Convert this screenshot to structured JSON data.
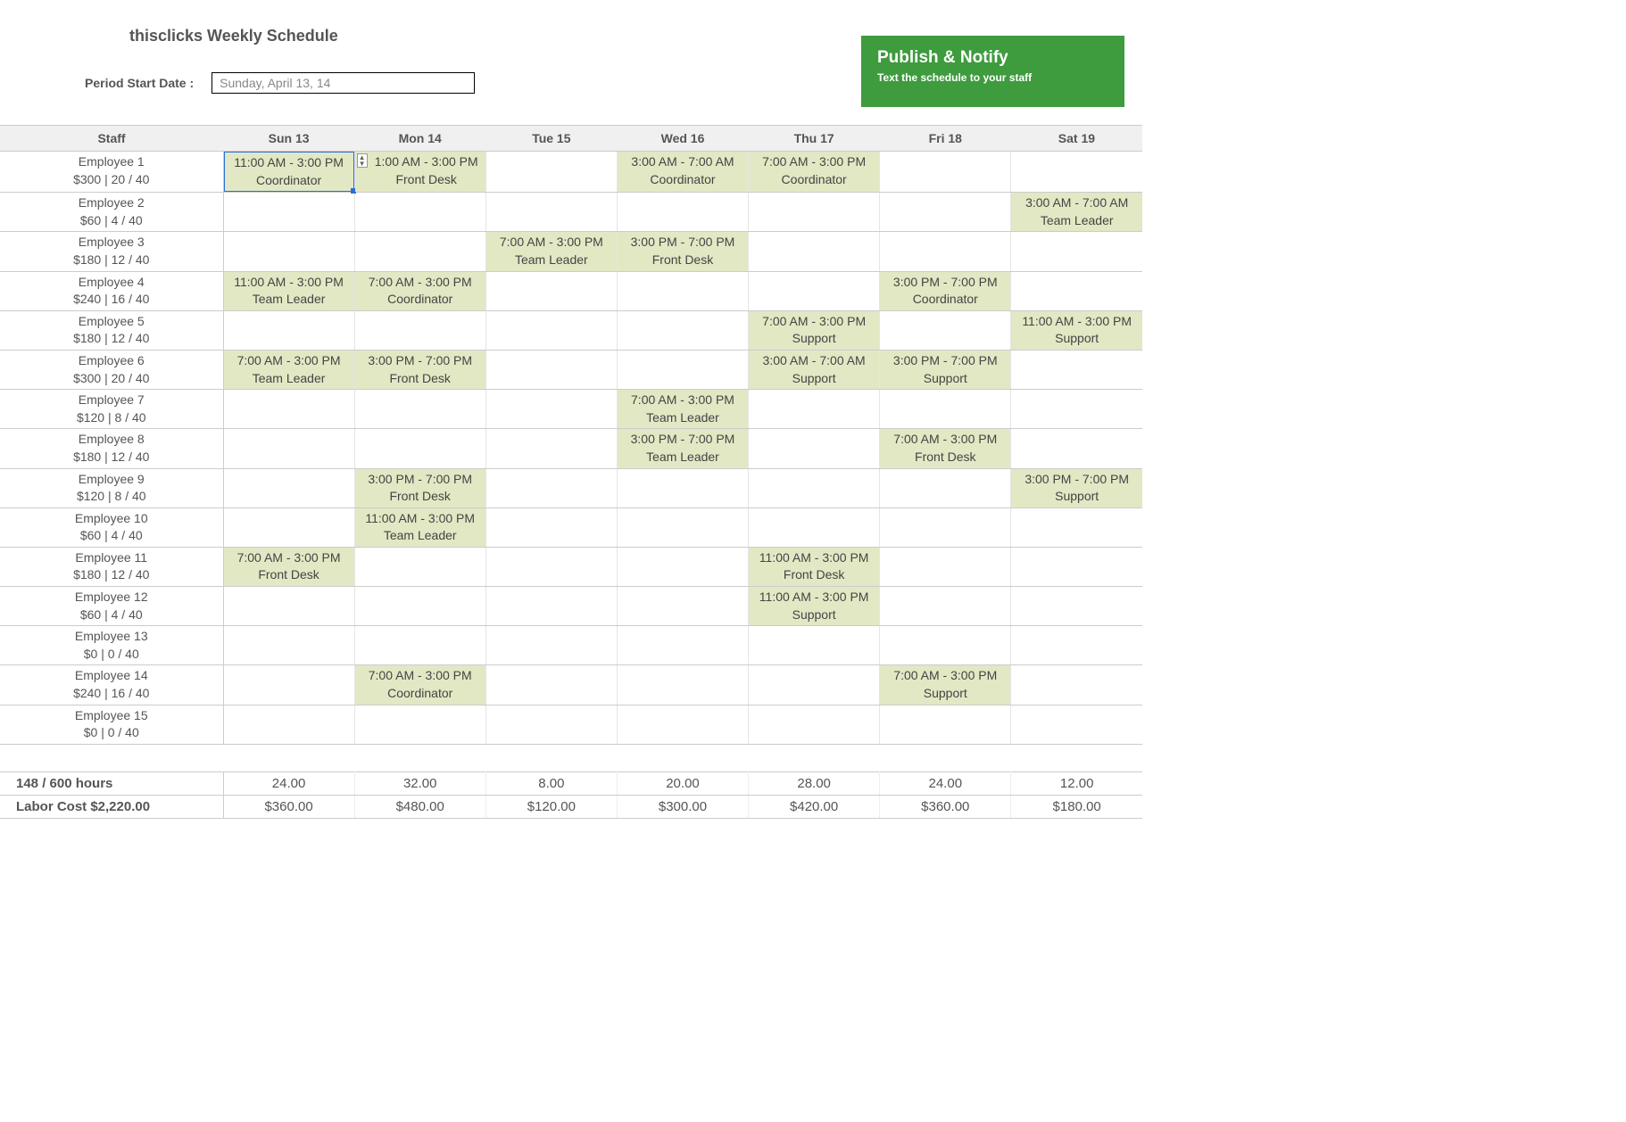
{
  "header": {
    "title": "thisclicks Weekly Schedule",
    "period_label": "Period Start Date :",
    "period_value": "Sunday, April 13, 14"
  },
  "publish": {
    "title": "Publish & Notify",
    "subtitle": "Text the schedule to your staff"
  },
  "columns": [
    "Staff",
    "Sun 13",
    "Mon 14",
    "Tue 15",
    "Wed 16",
    "Thu 17",
    "Fri 18",
    "Sat 19"
  ],
  "rows": [
    {
      "name": "Employee 1",
      "sub": "$300 | 20 / 40",
      "cells": [
        {
          "time": "11:00 AM - 3:00 PM",
          "role": "Coordinator",
          "selected": true
        },
        {
          "time": "1:00 AM - 3:00 PM",
          "role": "Front Desk",
          "stepper": true
        },
        null,
        {
          "time": "3:00 AM - 7:00 AM",
          "role": "Coordinator"
        },
        {
          "time": "7:00 AM - 3:00 PM",
          "role": "Coordinator"
        },
        null,
        null
      ]
    },
    {
      "name": "Employee 2",
      "sub": "$60 | 4 / 40",
      "cells": [
        null,
        null,
        null,
        null,
        null,
        null,
        {
          "time": "3:00 AM - 7:00 AM",
          "role": "Team Leader"
        }
      ]
    },
    {
      "name": "Employee 3",
      "sub": "$180 | 12 / 40",
      "cells": [
        null,
        null,
        {
          "time": "7:00 AM - 3:00 PM",
          "role": "Team Leader"
        },
        {
          "time": "3:00 PM - 7:00 PM",
          "role": "Front Desk"
        },
        null,
        null,
        null
      ]
    },
    {
      "name": "Employee 4",
      "sub": "$240 | 16 / 40",
      "cells": [
        {
          "time": "11:00 AM - 3:00 PM",
          "role": "Team Leader"
        },
        {
          "time": "7:00 AM - 3:00 PM",
          "role": "Coordinator"
        },
        null,
        null,
        null,
        {
          "time": "3:00 PM - 7:00 PM",
          "role": "Coordinator"
        },
        null
      ]
    },
    {
      "name": "Employee 5",
      "sub": "$180 | 12 / 40",
      "cells": [
        null,
        null,
        null,
        null,
        {
          "time": "7:00 AM - 3:00 PM",
          "role": "Support"
        },
        null,
        {
          "time": "11:00 AM - 3:00 PM",
          "role": "Support"
        }
      ]
    },
    {
      "name": "Employee 6",
      "sub": "$300 | 20 / 40",
      "cells": [
        {
          "time": "7:00 AM - 3:00 PM",
          "role": "Team Leader"
        },
        {
          "time": "3:00 PM - 7:00 PM",
          "role": "Front Desk"
        },
        null,
        null,
        {
          "time": "3:00 AM - 7:00 AM",
          "role": "Support"
        },
        {
          "time": "3:00 PM - 7:00 PM",
          "role": "Support"
        },
        null
      ]
    },
    {
      "name": "Employee 7",
      "sub": "$120 | 8 / 40",
      "cells": [
        null,
        null,
        null,
        {
          "time": "7:00 AM - 3:00 PM",
          "role": "Team Leader"
        },
        null,
        null,
        null
      ]
    },
    {
      "name": "Employee 8",
      "sub": "$180 | 12 / 40",
      "cells": [
        null,
        null,
        null,
        {
          "time": "3:00 PM - 7:00 PM",
          "role": "Team Leader"
        },
        null,
        {
          "time": "7:00 AM - 3:00 PM",
          "role": "Front Desk"
        },
        null
      ]
    },
    {
      "name": "Employee 9",
      "sub": "$120 | 8 / 40",
      "cells": [
        null,
        {
          "time": "3:00 PM - 7:00 PM",
          "role": "Front Desk"
        },
        null,
        null,
        null,
        null,
        {
          "time": "3:00 PM - 7:00 PM",
          "role": "Support"
        }
      ]
    },
    {
      "name": "Employee 10",
      "sub": "$60 | 4 / 40",
      "cells": [
        null,
        {
          "time": "11:00 AM - 3:00 PM",
          "role": "Team Leader"
        },
        null,
        null,
        null,
        null,
        null
      ]
    },
    {
      "name": "Employee 11",
      "sub": "$180 | 12 / 40",
      "cells": [
        {
          "time": "7:00 AM - 3:00 PM",
          "role": "Front Desk"
        },
        null,
        null,
        null,
        {
          "time": "11:00 AM - 3:00 PM",
          "role": "Front Desk"
        },
        null,
        null
      ]
    },
    {
      "name": "Employee 12",
      "sub": "$60 | 4 / 40",
      "cells": [
        null,
        null,
        null,
        null,
        {
          "time": "11:00 AM - 3:00 PM",
          "role": "Support"
        },
        null,
        null
      ]
    },
    {
      "name": "Employee 13",
      "sub": "$0 | 0 / 40",
      "cells": [
        null,
        null,
        null,
        null,
        null,
        null,
        null
      ]
    },
    {
      "name": "Employee 14",
      "sub": "$240 | 16 / 40",
      "cells": [
        null,
        {
          "time": "7:00 AM - 3:00 PM",
          "role": "Coordinator"
        },
        null,
        null,
        null,
        {
          "time": "7:00 AM - 3:00 PM",
          "role": "Support"
        },
        null
      ]
    },
    {
      "name": "Employee 15",
      "sub": "$0 | 0 / 40",
      "cells": [
        null,
        null,
        null,
        null,
        null,
        null,
        null
      ]
    }
  ],
  "summary": {
    "hours_label": "148 / 600 hours",
    "cost_label": "Labor Cost $2,220.00",
    "hours": [
      "24.00",
      "32.00",
      "8.00",
      "20.00",
      "28.00",
      "24.00",
      "12.00"
    ],
    "costs": [
      "$360.00",
      "$480.00",
      "$120.00",
      "$300.00",
      "$420.00",
      "$360.00",
      "$180.00"
    ]
  }
}
